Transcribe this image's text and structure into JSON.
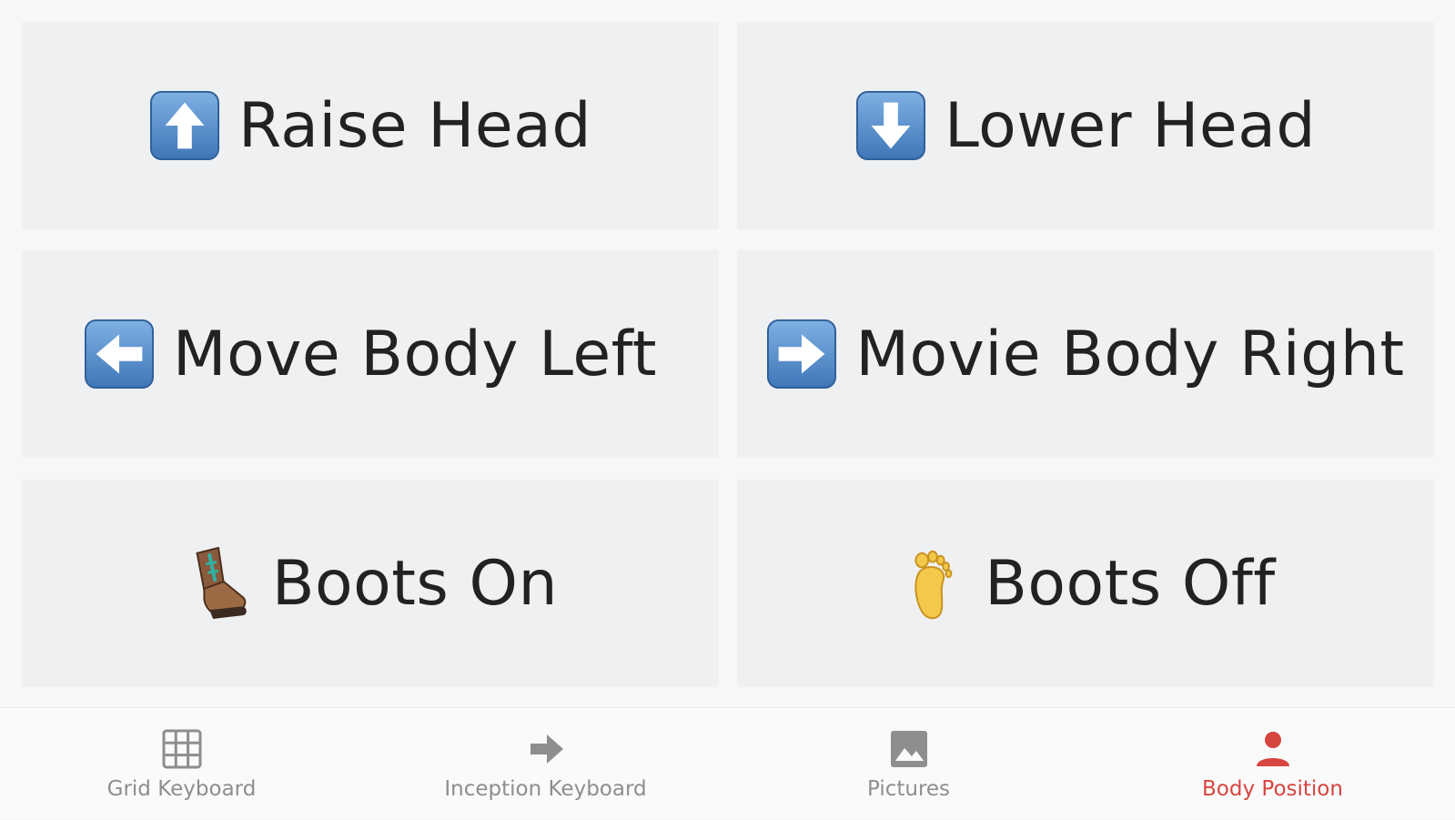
{
  "tiles": [
    {
      "label": "Raise Head",
      "icon": "up-arrow-icon"
    },
    {
      "label": "Lower Head",
      "icon": "down-arrow-icon"
    },
    {
      "label": "Move Body Left",
      "icon": "left-arrow-icon"
    },
    {
      "label": "Movie Body Right",
      "icon": "right-arrow-icon"
    },
    {
      "label": "Boots On",
      "icon": "hiking-boot-icon"
    },
    {
      "label": "Boots Off",
      "icon": "footprint-icon"
    }
  ],
  "bottom_nav": {
    "items": [
      {
        "label": "Grid Keyboard",
        "icon": "grid-icon",
        "active": false
      },
      {
        "label": "Inception Keyboard",
        "icon": "arrow-right-icon",
        "active": false
      },
      {
        "label": "Pictures",
        "icon": "image-icon",
        "active": false
      },
      {
        "label": "Body Position",
        "icon": "person-icon",
        "active": true
      }
    ]
  },
  "colors": {
    "tile_background": "#eff0f1",
    "page_background": "#f7f7f7",
    "active_tab": "#d6453f",
    "inactive_tab": "#8e8e8e",
    "arrow_box": "#5b8fc7"
  }
}
